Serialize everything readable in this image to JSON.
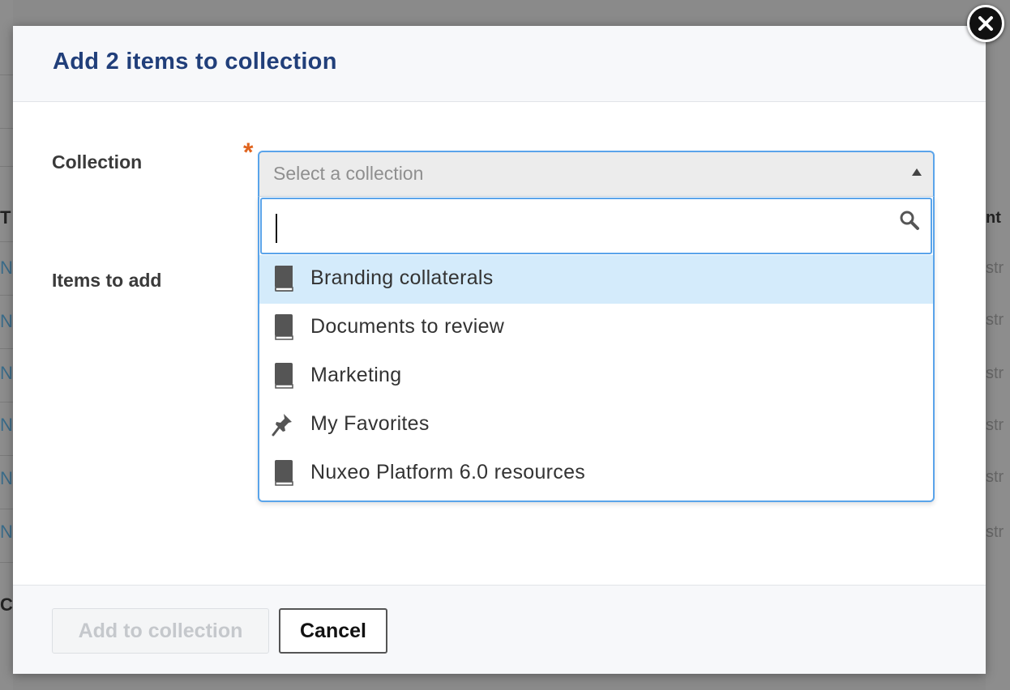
{
  "background": {
    "left_letters": [
      "T",
      "N",
      "N",
      "N",
      "N",
      "N",
      "N",
      "C"
    ],
    "right_fragments": [
      "nt",
      "str",
      "str",
      "str",
      "str",
      "str",
      "str"
    ]
  },
  "dialog": {
    "title": "Add 2 items to collection",
    "close_icon": "close-x-icon"
  },
  "form": {
    "collection_label": "Collection",
    "required_marker": "*",
    "select_placeholder": "Select a collection",
    "items_label": "Items to add"
  },
  "dropdown": {
    "search_value": "",
    "search_icon": "magnifier-icon",
    "options": [
      {
        "label": "Branding collaterals",
        "icon": "book-icon",
        "highlighted": true
      },
      {
        "label": "Documents to review",
        "icon": "book-icon",
        "highlighted": false
      },
      {
        "label": "Marketing",
        "icon": "book-icon",
        "highlighted": false
      },
      {
        "label": "My Favorites",
        "icon": "pin-icon",
        "highlighted": false
      },
      {
        "label": "Nuxeo Platform 6.0 resources",
        "icon": "book-icon",
        "highlighted": false
      }
    ]
  },
  "footer": {
    "add_label": "Add to collection",
    "cancel_label": "Cancel"
  },
  "colors": {
    "title": "#213f7a",
    "focus_border": "#5aa4ea",
    "highlight": "#d4ebfb",
    "required": "#e0641e"
  }
}
